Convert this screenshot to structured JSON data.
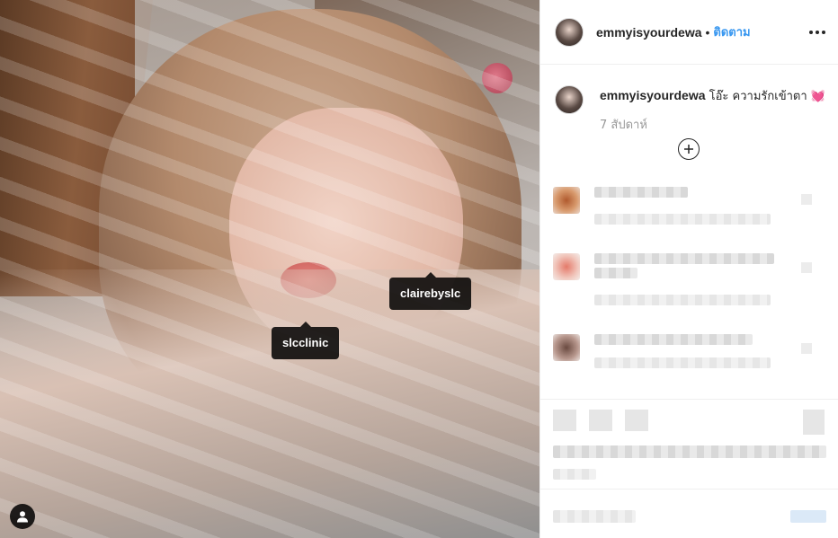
{
  "post": {
    "tags": [
      {
        "label": "clairebyslc"
      },
      {
        "label": "slcclinic"
      }
    ]
  },
  "header": {
    "username": "emmyisyourdewa",
    "separator": "•",
    "follow_label": "ติดตาม"
  },
  "caption": {
    "username": "emmyisyourdewa",
    "text": "โอ๊ะ ความรักเข้าตา",
    "emoji": "💓",
    "time": "7 สัปดาห์"
  },
  "colors": {
    "follow_link": "#3897f0",
    "username_text": "#262626",
    "timestamp_text": "#999999",
    "tag_background": "#000000"
  },
  "icons": {
    "more": "more-horizontal-icon",
    "load_more": "plus-circle-icon",
    "user_tags": "user-icon"
  }
}
